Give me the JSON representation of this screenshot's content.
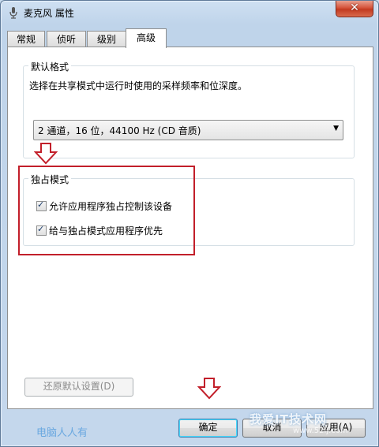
{
  "window": {
    "title": "麦克风 属性",
    "close_glyph": "✕"
  },
  "tabs": [
    {
      "label": "常规"
    },
    {
      "label": "侦听"
    },
    {
      "label": "级别"
    },
    {
      "label": "高级",
      "active": true
    }
  ],
  "default_format": {
    "group_label": "默认格式",
    "description": "选择在共享模式中运行时使用的采样频率和位深度。",
    "selected": "2 通道，16 位，44100 Hz (CD 音质)"
  },
  "exclusive_mode": {
    "group_label": "独占模式",
    "options": [
      {
        "label": "允许应用程序独占控制该设备",
        "checked": true
      },
      {
        "label": "给与独占模式应用程序优先",
        "checked": true
      }
    ]
  },
  "buttons": {
    "restore_defaults": "还原默认设置(D)",
    "ok": "确定",
    "cancel": "取消",
    "apply": "应用(A)"
  },
  "watermarks": {
    "left": "电脑人人有",
    "right": "我爱IT技术网",
    "right_sub": "www.52ij.com"
  },
  "colors": {
    "highlight_red": "#c21f2a",
    "arrow_red": "#c21f2a"
  }
}
